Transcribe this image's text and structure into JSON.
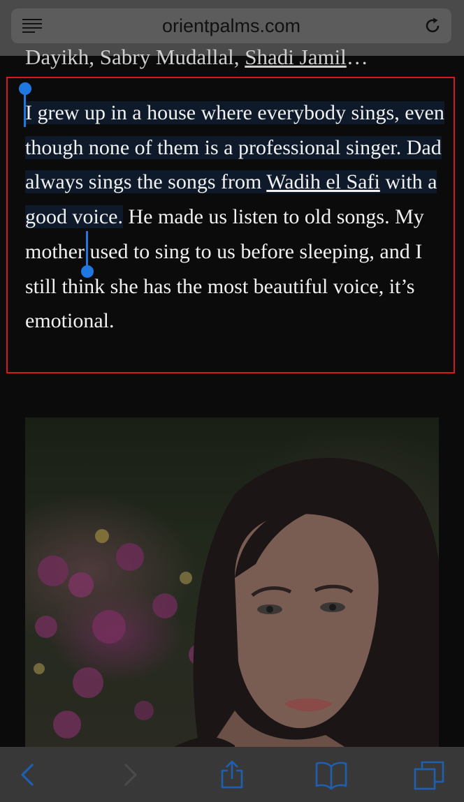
{
  "browser": {
    "url": "orientpalms.com",
    "icons": {
      "reader": "reader-view-icon",
      "reload": "reload-icon"
    }
  },
  "article": {
    "prev_line_prefix": "Dayikh, Sabry Mudallal, ",
    "prev_line_link": "Shadi Jamil",
    "prev_line_suffix": "…",
    "paragraph": {
      "selected_part1": "I grew up in a house where everybody sings, even though none of them is a professional singer. Dad always sings the songs from ",
      "selected_link": "Wadih el Safi",
      "selected_part2": " with a good voice.",
      "unselected": " He made us listen to old songs. My mother used to sing to us before sleeping, and I still think she has the most beautiful voice, it’s emotional."
    },
    "image": "portrait-photo"
  },
  "toolbar": {
    "back": "back-icon",
    "forward": "forward-icon",
    "share": "share-icon",
    "bookmarks": "bookmarks-icon",
    "tabs": "tabs-icon"
  },
  "colors": {
    "accent": "#1e78e0",
    "selection": "#0e1a2a",
    "highlight_border": "#d81818"
  }
}
